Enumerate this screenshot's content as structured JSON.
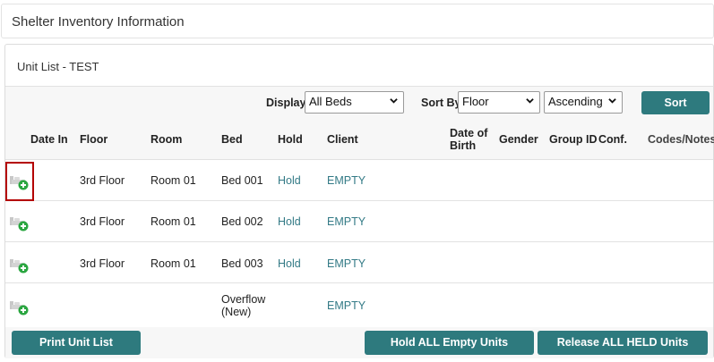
{
  "page": {
    "title": "Shelter Inventory Information"
  },
  "panel": {
    "title": "Unit List - TEST"
  },
  "controls": {
    "display_label": "Display",
    "display_value": "All Beds",
    "sort_by_label": "Sort By",
    "sort_by_value": "Floor",
    "order_value": "Ascending",
    "sort_button": "Sort"
  },
  "columns": {
    "date_in": "Date In",
    "floor": "Floor",
    "room": "Room",
    "bed": "Bed",
    "hold": "Hold",
    "client": "Client",
    "dob_line1": "Date of",
    "dob_line2": "Birth",
    "gender": "Gender",
    "group_id": "Group ID",
    "conf": "Conf.",
    "codes_notes": "Codes/Notes"
  },
  "rows": [
    {
      "floor": "3rd Floor",
      "room": "Room 01",
      "bed": "Bed 001",
      "bed_line2": "",
      "hold": "Hold",
      "client": "EMPTY"
    },
    {
      "floor": "3rd Floor",
      "room": "Room 01",
      "bed": "Bed 002",
      "bed_line2": "",
      "hold": "Hold",
      "client": "EMPTY"
    },
    {
      "floor": "3rd Floor",
      "room": "Room 01",
      "bed": "Bed 003",
      "bed_line2": "",
      "hold": "Hold",
      "client": "EMPTY"
    },
    {
      "floor": "",
      "room": "",
      "bed": "Overflow",
      "bed_line2": "(New)",
      "hold": "",
      "client": "EMPTY"
    }
  ],
  "footer": {
    "print_button": "Print Unit List",
    "hold_all_button": "Hold ALL Empty Units",
    "release_all_button": "Release ALL HELD Units"
  },
  "colors": {
    "accent": "#2e7a7e",
    "link": "#337a86",
    "highlight": "#b40000"
  },
  "icons": {
    "row_action": "bed-add-icon",
    "select_arrow": "chevron-down-icon"
  }
}
